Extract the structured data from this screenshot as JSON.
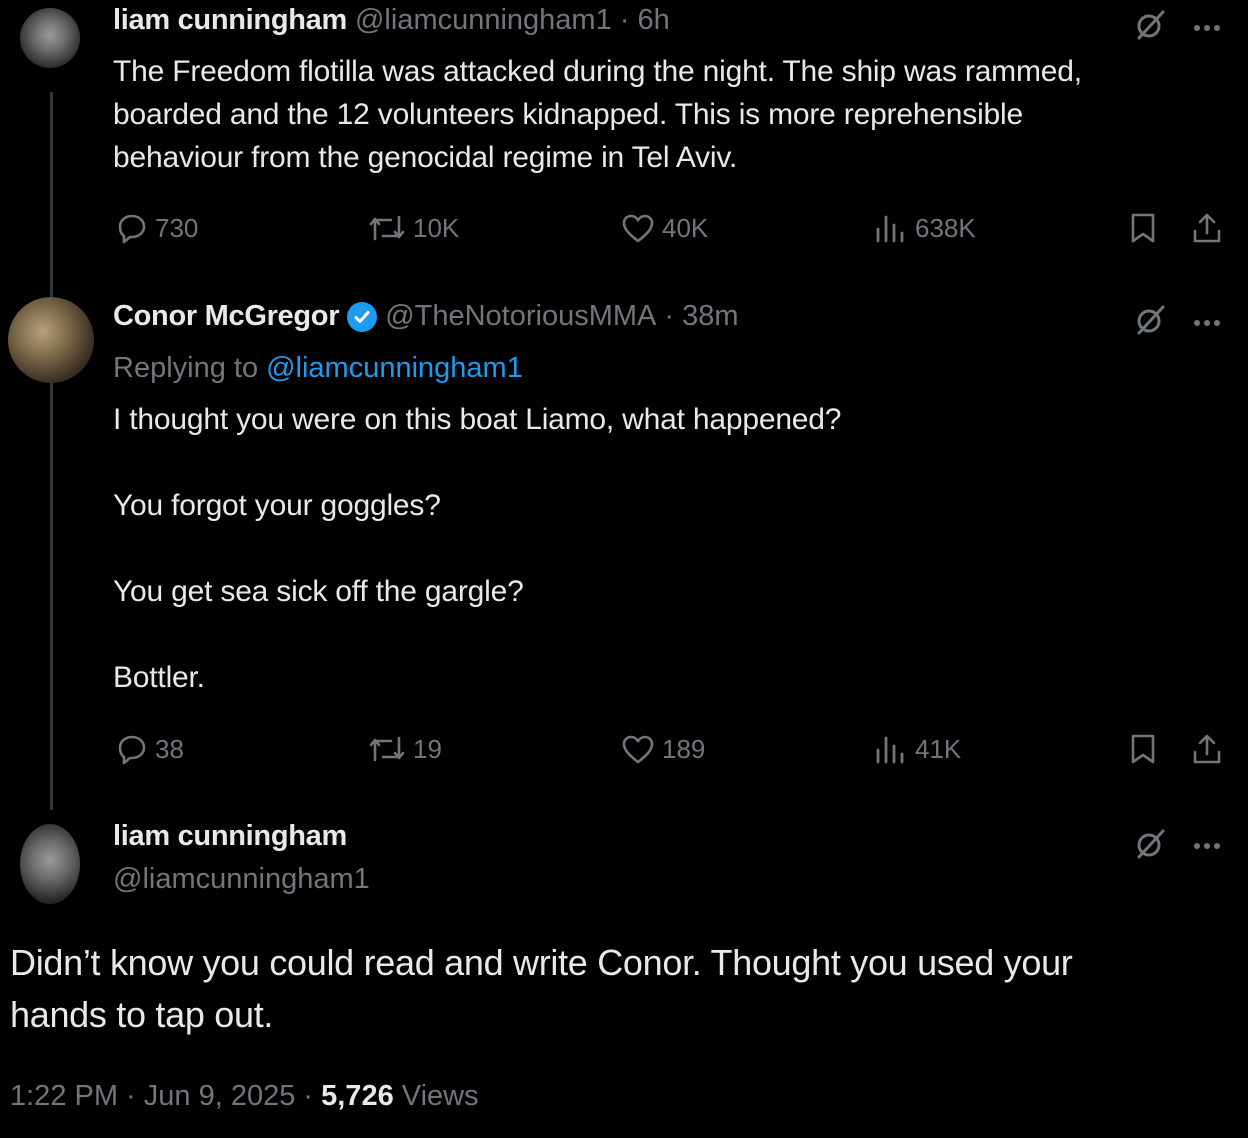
{
  "tweets": [
    {
      "display_name": "liam cunningham",
      "handle": "@liamcunningham1",
      "time": "· 6h",
      "lines": [
        "The Freedom flotilla was attacked during the night. The ship was rammed,",
        "boarded and the 12 volunteers kidnapped. This is more reprehensible",
        "behaviour from the genocidal regime in Tel Aviv."
      ],
      "replies": "730",
      "reposts": "10K",
      "likes": "40K",
      "views": "638K"
    },
    {
      "display_name": "Conor McGregor",
      "handle": "@TheNotoriousMMA",
      "time": "· 38m",
      "replying_prefix": "Replying to",
      "replying_to": "@liamcunningham1",
      "paragraphs": [
        "I thought you were on this boat Liamo, what happened?",
        "You forgot your goggles?",
        "You get sea sick off the gargle?",
        "Bottler."
      ],
      "replies": "38",
      "reposts": "19",
      "likes": "189",
      "views": "41K"
    }
  ],
  "main_tweet": {
    "display_name": "liam cunningham",
    "handle": "@liamcunningham1",
    "lines": [
      "Didn’t know you could read and write Conor. Thought you used your",
      "hands to tap out."
    ],
    "time": "1:22 PM · Jun 9, 2025 · ",
    "views_count": "5,726",
    "views_label": "Views"
  },
  "icons": [
    "grok-icon",
    "more-icon",
    "reply-icon",
    "repost-icon",
    "like-icon",
    "views-icon",
    "bookmark-icon",
    "share-icon",
    "verified-badge-icon"
  ],
  "colors": {
    "background": "#000000",
    "text": "#e7e9ea",
    "muted": "#71767b",
    "link": "#1d9bf0"
  }
}
